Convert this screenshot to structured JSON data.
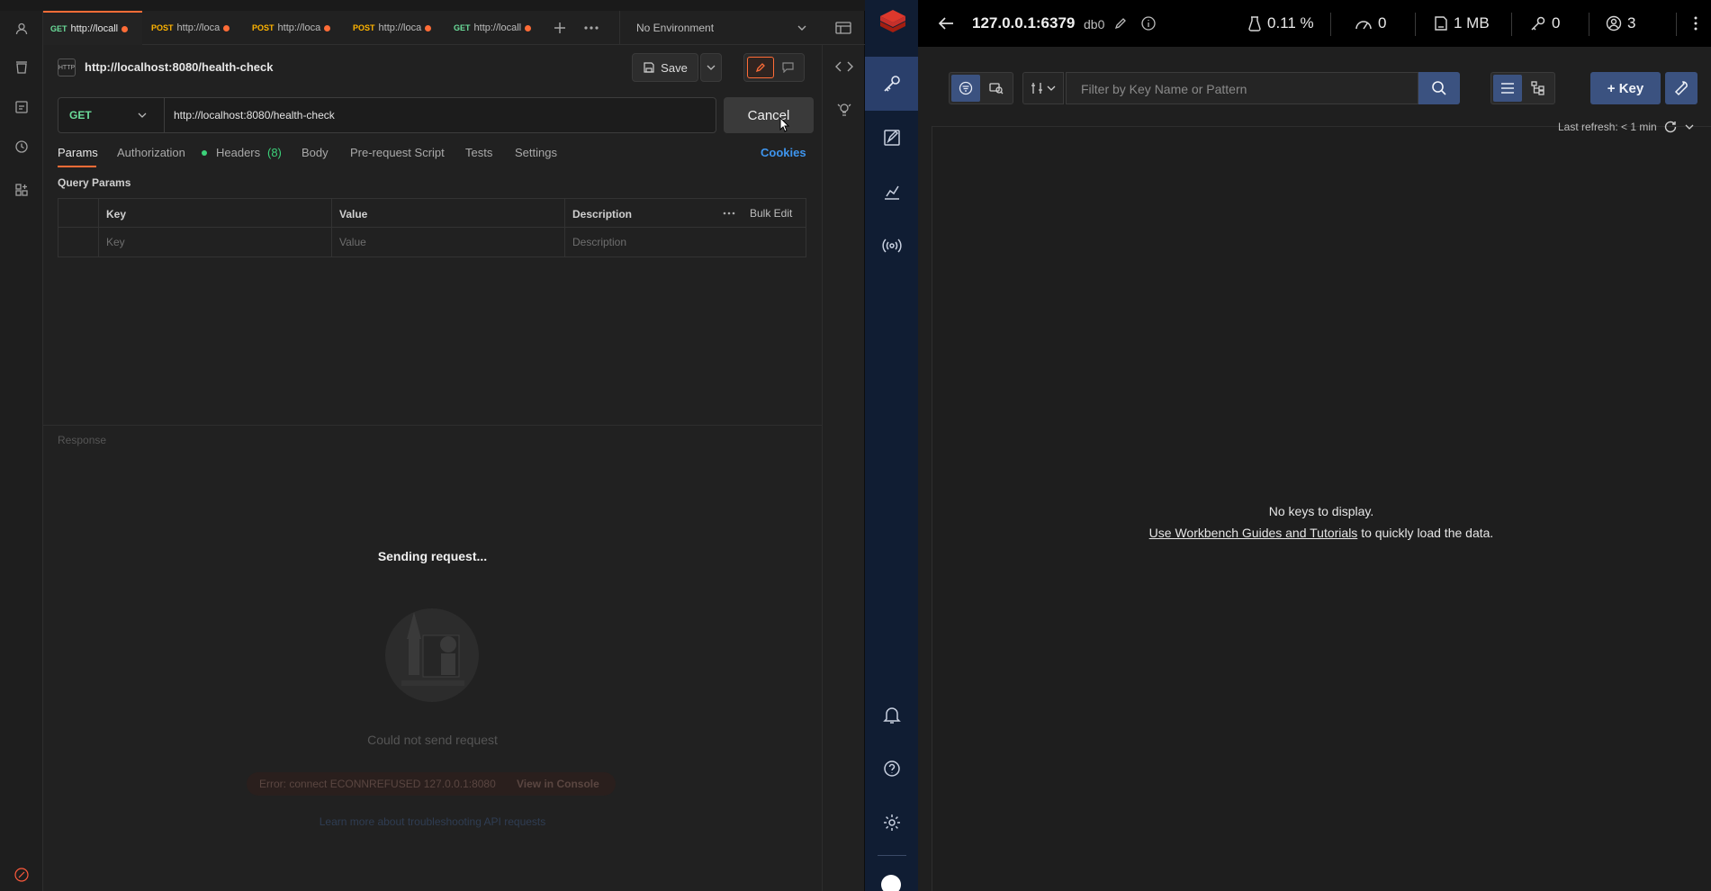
{
  "postman": {
    "tabs": [
      {
        "method": "GET",
        "url": "http://locall"
      },
      {
        "method": "POST",
        "url": "http://loca"
      },
      {
        "method": "POST",
        "url": "http://loca"
      },
      {
        "method": "POST",
        "url": "http://loca"
      },
      {
        "method": "GET",
        "url": "http://locall"
      }
    ],
    "environment": "No Environment",
    "request_title": "http://localhost:8080/health-check",
    "save_label": "Save",
    "method": "GET",
    "url": "http://localhost:8080/health-check",
    "cancel_label": "Cancel",
    "request_tabs": {
      "params": "Params",
      "authorization": "Authorization",
      "headers": "Headers",
      "headers_count": "(8)",
      "body": "Body",
      "prerequest": "Pre-request Script",
      "tests": "Tests",
      "settings": "Settings",
      "cookies": "Cookies"
    },
    "query_params_label": "Query Params",
    "table": {
      "headers": [
        "Key",
        "Value",
        "Description"
      ],
      "bulk_edit": "Bulk Edit",
      "placeholders": [
        "Key",
        "Value",
        "Description"
      ]
    },
    "response_label": "Response",
    "sending": "Sending request...",
    "could_not_send": "Could not send request",
    "error": "Error: connect ECONNREFUSED 127.0.0.1:8080",
    "view_console": "View in Console",
    "learn_more": "Learn more about troubleshooting API requests"
  },
  "redis": {
    "host": "127.0.0.1:6379",
    "db": "db0",
    "stats": {
      "cpu": "0.11 %",
      "ops": "0",
      "memory": "1 MB",
      "keys": "0",
      "clients": "3"
    },
    "filter_placeholder": "Filter by Key Name or Pattern",
    "add_key": "+ Key",
    "last_refresh": "Last refresh: < 1 min",
    "empty_title": "No keys to display.",
    "empty_link": "Use Workbench Guides and Tutorials",
    "empty_suffix": " to quickly load the data."
  }
}
